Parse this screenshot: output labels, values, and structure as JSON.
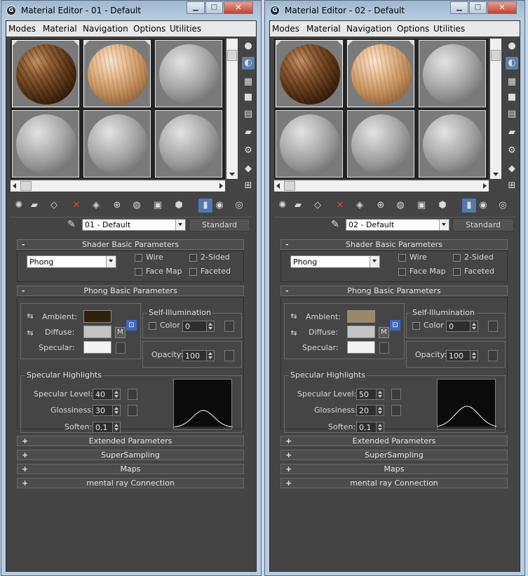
{
  "windows": [
    {
      "title": "Material Editor - 01 - Default",
      "menu": [
        "Modes",
        "Material",
        "Navigation",
        "Options",
        "Utilities"
      ],
      "material_name": "01 - Default",
      "material_type": "Standard",
      "slots": [
        "brown",
        "light",
        "gray",
        "gray",
        "gray",
        "gray"
      ],
      "shader": {
        "title": "Shader Basic Parameters",
        "type": "Phong",
        "wire": "Wire",
        "two_sided": "2-Sided",
        "face_map": "Face Map",
        "faceted": "Faceted"
      },
      "basic": {
        "title": "Phong Basic Parameters",
        "ambient_label": "Ambient:",
        "diffuse_label": "Diffuse:",
        "specular_label": "Specular:",
        "ambient_color": "#2e220a",
        "diffuse_color": "#c4c4c4",
        "specular_color": "#f3f3f3",
        "m_label": "M",
        "self_illum_title": "Self-Illumination",
        "color_label": "Color",
        "self_illum_value": "0",
        "opacity_label": "Opacity:",
        "opacity_value": "100"
      },
      "highlights": {
        "title": "Specular Highlights",
        "level_label": "Specular Level:",
        "level": "40",
        "gloss_label": "Glossiness:",
        "gloss": "30",
        "soften_label": "Soften:",
        "soften": "0,1"
      },
      "rollouts": [
        "Extended Parameters",
        "SuperSampling",
        "Maps",
        "mental ray Connection"
      ]
    },
    {
      "title": "Material Editor - 02 - Default",
      "menu": [
        "Modes",
        "Material",
        "Navigation",
        "Options",
        "Utilities"
      ],
      "material_name": "02 - Default",
      "material_type": "Standard",
      "slots": [
        "brown",
        "light",
        "gray",
        "gray",
        "gray",
        "gray"
      ],
      "shader": {
        "title": "Shader Basic Parameters",
        "type": "Phong",
        "wire": "Wire",
        "two_sided": "2-Sided",
        "face_map": "Face Map",
        "faceted": "Faceted"
      },
      "basic": {
        "title": "Phong Basic Parameters",
        "ambient_label": "Ambient:",
        "diffuse_label": "Diffuse:",
        "specular_label": "Specular:",
        "ambient_color": "#9c8868",
        "diffuse_color": "#c4c4c4",
        "specular_color": "#f3f3f3",
        "m_label": "M",
        "self_illum_title": "Self-Illumination",
        "color_label": "Color",
        "self_illum_value": "0",
        "opacity_label": "Opacity:",
        "opacity_value": "100"
      },
      "highlights": {
        "title": "Specular Highlights",
        "level_label": "Specular Level:",
        "level": "50",
        "gloss_label": "Glossiness:",
        "gloss": "20",
        "soften_label": "Soften:",
        "soften": "0,1"
      },
      "rollouts": [
        "Extended Parameters",
        "SuperSampling",
        "Maps",
        "mental ray Connection"
      ]
    }
  ],
  "caption_buttons": {
    "minimize": "▁",
    "maximize": "□",
    "close": "✕"
  },
  "rollout_collapse": "-",
  "rollout_expand": "+",
  "icons": {
    "side_tools": [
      "sample-type-sphere-icon",
      "backlight-icon",
      "background-checker-icon",
      "sample-uv-tiling-icon",
      "video-color-check-icon",
      "make-preview-icon",
      "options-icon",
      "select-by-material-icon",
      "material-navigator-icon"
    ],
    "bottom_tools": [
      "get-material-icon",
      "put-to-scene-icon",
      "assign-to-selection-icon",
      "reset-map-icon",
      "make-unique-icon",
      "put-to-library-icon",
      "material-id-channel-icon",
      "show-map-in-viewport-icon",
      "show-end-result-icon",
      "go-to-parent-icon",
      "go-forward-to-sibling-icon"
    ]
  }
}
